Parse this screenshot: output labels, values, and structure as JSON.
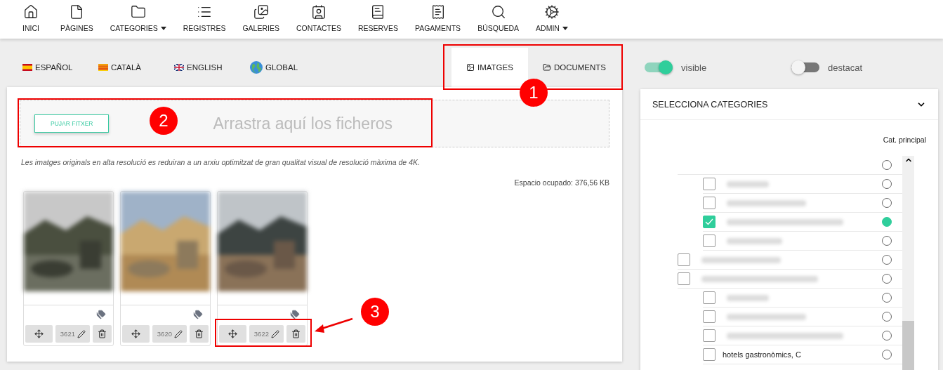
{
  "nav": [
    {
      "label": "INICI",
      "dropdown": false
    },
    {
      "label": "PÀGINES",
      "dropdown": false
    },
    {
      "label": "CATEGORIES",
      "dropdown": true
    },
    {
      "label": "REGISTRES",
      "dropdown": false
    },
    {
      "label": "GALERIES",
      "dropdown": false
    },
    {
      "label": "CONTACTES",
      "dropdown": false
    },
    {
      "label": "RESERVES",
      "dropdown": false
    },
    {
      "label": "PAGAMENTS",
      "dropdown": false
    },
    {
      "label": "BÚSQUEDA",
      "dropdown": false
    },
    {
      "label": "ADMIN",
      "dropdown": true
    }
  ],
  "languages": [
    {
      "label": "ESPAÑOL"
    },
    {
      "label": "CATALÀ"
    },
    {
      "label": "ENGLISH"
    },
    {
      "label": "GLOBAL"
    }
  ],
  "media_tabs": [
    {
      "label": "IMATGES",
      "selected": true
    },
    {
      "label": "DOCUMENTS",
      "selected": false
    }
  ],
  "toggles": [
    {
      "label": "visible",
      "on": true
    },
    {
      "label": "destacat",
      "on": false
    }
  ],
  "upload": {
    "button": "PUJAR FITXER",
    "drop_hint": "Arrastra aquí los ficheros"
  },
  "note": "Les imatges originals en alta resolució es reduiran a un arxiu optimitzat de gran qualitat visual de resolució màxima de 4K.",
  "usage": "Espacio ocupado: 376,56 KB",
  "images": [
    {
      "id": "3621"
    },
    {
      "id": "3620"
    },
    {
      "id": "3622"
    }
  ],
  "categories_panel": {
    "title": "SELECCIONA CATEGORIES",
    "expanded": true,
    "column": "Cat. principal",
    "items": [
      {
        "main": false,
        "children": [
          {
            "checked": false,
            "main": false
          },
          {
            "checked": false,
            "main": false
          },
          {
            "checked": true,
            "main": true
          },
          {
            "checked": false,
            "main": false
          }
        ]
      },
      {
        "checked": false,
        "main": false
      },
      {
        "checked": false,
        "main": false,
        "children": [
          {
            "checked": false,
            "main": false
          },
          {
            "checked": false,
            "main": false
          },
          {
            "checked": false,
            "main": false
          },
          {
            "checked": false,
            "main": false,
            "label": "hotels gastronòmics, C"
          }
        ]
      }
    ]
  },
  "annotations": [
    {
      "number": "1"
    },
    {
      "number": "2"
    },
    {
      "number": "3"
    }
  ]
}
